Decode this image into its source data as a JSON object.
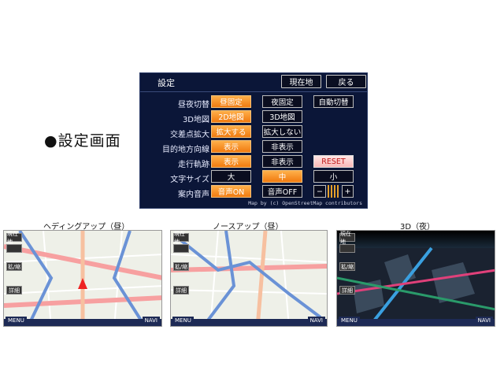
{
  "section_heading": "●設定画面",
  "settings": {
    "title": "設定",
    "current_location_button": "現在地",
    "back_button": "戻る",
    "rows": [
      {
        "label": "昼夜切替",
        "options": [
          "昼固定",
          "夜固定",
          "自動切替"
        ],
        "selected": 0
      },
      {
        "label": "3D地図",
        "options": [
          "2D地図",
          "3D地図"
        ],
        "selected": 0
      },
      {
        "label": "交差点拡大",
        "options": [
          "拡大する",
          "拡大しない"
        ],
        "selected": 0
      },
      {
        "label": "目的地方向線",
        "options": [
          "表示",
          "非表示"
        ],
        "selected": 0
      },
      {
        "label": "走行軌跡",
        "options": [
          "表示",
          "非表示",
          "RESET"
        ],
        "selected": 0
      },
      {
        "label": "文字サイズ",
        "options": [
          "大",
          "中",
          "小"
        ],
        "selected": 1
      },
      {
        "label": "案内音声",
        "options": [
          "音声ON",
          "音声OFF"
        ],
        "selected": 0
      }
    ],
    "volume_minus": "−",
    "volume_plus": "+",
    "credit": "Map by (c) OpenStreetMap contributors"
  },
  "maps": [
    {
      "caption": "ヘディングアップ（昼）",
      "side_buttons": [
        "現在地",
        "",
        "拡/縮",
        "詳細"
      ],
      "menu": "MENU",
      "navi": "NAVI"
    },
    {
      "caption": "ノースアップ（昼）",
      "side_buttons": [
        "現在地",
        "",
        "拡/縮",
        "詳細"
      ],
      "menu": "MENU",
      "navi": "NAVI"
    },
    {
      "caption": "3D（夜）",
      "side_buttons": [
        "現在地",
        "",
        "拡/縮",
        "詳細"
      ],
      "menu": "MENU",
      "navi": "NAVI"
    }
  ]
}
